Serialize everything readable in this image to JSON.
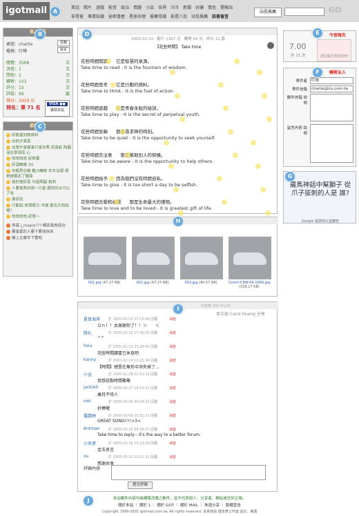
{
  "header": {
    "logo": "igotmail",
    "nav_top": [
      "笑話",
      "開片",
      "遊戲",
      "影音",
      "政治",
      "情趣",
      "小品",
      "各界",
      "冷冷",
      "新聞",
      "好康",
      "情色",
      "開報站"
    ],
    "nav_bottom": [
      "非賣客",
      "專業知識",
      "祕密書屋",
      "星座命理",
      "醫藥常識",
      "影星八卦",
      "站長推薦",
      "訪客留言"
    ],
    "nav_active": "訪客留言",
    "site_recommend": "站長推薦",
    "search_value": "",
    "go": "GO"
  },
  "profile": {
    "title": "個人資訊",
    "account_label": "帳號：charlie",
    "account_btn": "信箱",
    "nickname_label": "暱稱：叮嚀",
    "nickname_btn": "留言",
    "stats": [
      {
        "label": "閱覽：3568",
        "value": "次"
      },
      {
        "label": "消音：1",
        "value": "次"
      },
      {
        "label": "問他：2",
        "value": "次"
      },
      {
        "label": "轉寄：103",
        "value": "次"
      },
      {
        "label": "評分：15",
        "value": "次"
      },
      {
        "label": "評語：96",
        "value": "篇"
      }
    ],
    "score": "得分：2929 分",
    "rank": "排名：第 71 名",
    "paypal_label": "贊助本站"
  },
  "latest": {
    "title": "最新發言",
    "items": [
      "好像還到無資料",
      "台西子蒸豪",
      "台灣不會做事只會作秀 的遠欽 阿國泡在學淚底 心",
      "哈哈哈哈 好笑喔",
      "好溫瞭曖 3Q",
      "年輕界自餐 難力轉移 年年法規 視是被鎖走了健康",
      "我的使好長 可是問題 寂莉",
      "人要會笑的唉～只是 顧完的太巧公了哈",
      "真好的",
      "只能說-有情愛方-不面 節去方到說嗎？",
      "哈哈哈哈-好笑～"
    ],
    "extra": [
      "恭喜 j_maple??? 網誌我用成功",
      "要是愛的人要下要快快來",
      "線上古童年下實啦"
    ]
  },
  "post": {
    "meta": "2005-02-13 ‧ 觀介 1307 次 ‧ 轉寄 64 次 ‧ 評分 11 篇",
    "title": "【花些時間】 Take time",
    "lines": [
      {
        "cn": "花些時間閱讀",
        "cn2": "它是智慧的泉源。",
        "en": "Take time to read  -  It is the fountain of wisdom."
      },
      {
        "cn": "花些時間思考",
        "cn2": "它是行動的燃料。",
        "en": "Take time to think  -  It is the fuel of action."
      },
      {
        "cn": "花些時間遊戲",
        "cn2": "它是青春永駐的秘訣。",
        "en": "Take time to play  -  It is the secret of perpetual youth."
      },
      {
        "cn": "花些時間安靜",
        "cn2": "那是尋求神的時刻。",
        "en": "Take time to be quiet  -  It is the opportunity to seek yourself."
      },
      {
        "cn": "花些時間去注意",
        "cn2": "那是幫助別人的契機。",
        "en": "Take time to be aware  -  It is the opportunity to help others."
      },
      {
        "cn": "花些時間給予",
        "cn2": "因為我們沒有時間自私。",
        "en": "Take time to give  -  It is too short a day to be selfish."
      },
      {
        "cn": "花些時間去愛和被愛",
        "cn2": "那是生命最大的禮物。",
        "en": "Take time to love and to be loved  -  It is greatest gift of life."
      }
    ]
  },
  "attachments": [
    {
      "name": "001.jpg",
      "size": "(47.27 KB)"
    },
    {
      "name": "002.jpg",
      "size": "(47.27 KB)"
    },
    {
      "name": "003.jpg",
      "size": "(40.57 KB)"
    },
    {
      "name": "Covini-C6W-09-1600.jpg",
      "size": "(156.17 KB)"
    }
  ],
  "comments": {
    "header_meta": "內容轉 200 字以內",
    "author": "本文由 Carol Huang 分享",
    "items": [
      {
        "name": "夏目海岸",
        "meta": "於 2005-02-13 17:15:40 回覆",
        "del": "消音",
        "text": "Ｏｈ！！太謝謝你了！！＞　　＜"
      },
      {
        "name": "隊扎",
        "meta": "於 2005-02-13 17:36:05 回覆",
        "del": "消音",
        "text": "^^"
      },
      {
        "name": "hsiu",
        "meta": "於 2005-02-13 21:28:40 回覆",
        "del": "消音",
        "text": "花些時間讀書已休息吧"
      },
      {
        "name": "kanny",
        "meta": "於 2005-02-14 12:25:54 回覆",
        "del": "消音",
        "text": "【時間】總是在無形中消失掉了..."
      },
      {
        "name": "小吉",
        "meta": "於 2005-02-28 21:51:14 回覆",
        "del": "消音",
        "text": "我想花點時間聚聚"
      },
      {
        "name": "jackie0",
        "meta": "於 2005-02-27 19:10:11 回覆",
        "del": "消音",
        "text": "歲月不待人"
      },
      {
        "name": "oxo",
        "meta": "於 2005-03-05 20:09:02 回覆",
        "del": "消音",
        "text": "好棒喔"
      },
      {
        "name": "羅蘭林",
        "meta": "於 2005-03-09 20:31:31 回覆",
        "del": "消音",
        "text": "GREAT SONG!!!!>3<"
      },
      {
        "name": "Antman",
        "meta": "於 2005-03-16 04:36:27 回覆",
        "del": "消音",
        "text": "Take time to reply-- it's the way to a better forum."
      },
      {
        "name": "小天使",
        "meta": "於 2005-03-16 15:23:56 回覆",
        "del": "消音",
        "text": "金玉良言"
      },
      {
        "name": "xu",
        "meta": "於 2005-03-20 10:22:31 回覆",
        "del": "消音",
        "text": "感謝共享"
      }
    ],
    "reply_label": "評論內容",
    "submit": "提交評論"
  },
  "counter": {
    "title": "今夜報名",
    "value": "7.00",
    "days": "共 21 次",
    "calendar_note": "請回覆非那時間吧"
  },
  "mailbox": {
    "title": "轉寄友人",
    "sender_label": "寄件者",
    "sender_value": "叮嚀",
    "email_label": "寄件信箱",
    "email_value": "charlie@ics.com.tw",
    "to_label": "郵件信箱 說明",
    "msg_label": "留言內容 說明"
  },
  "ad": {
    "text": "羅馬神話中幫獅子 從爪子拔刺的人是 誰?",
    "foot": "Google 提供的公益廣告"
  },
  "footer": {
    "line1": "本站郵件內容均為網路流傳之郵件，並不代表個人、分享者、網站或任何立場。",
    "line2": "關於本站 ｜ 關於 1 ｜ 關於 GOT ｜ 關於 MAIL ｜ 來函分享 ｜ 版權宣告",
    "line3": "Copyright 1999-2005 igotmail.com.tw. All rights reserved. 本系統由 捷圭彥工作室 設計，維護"
  }
}
